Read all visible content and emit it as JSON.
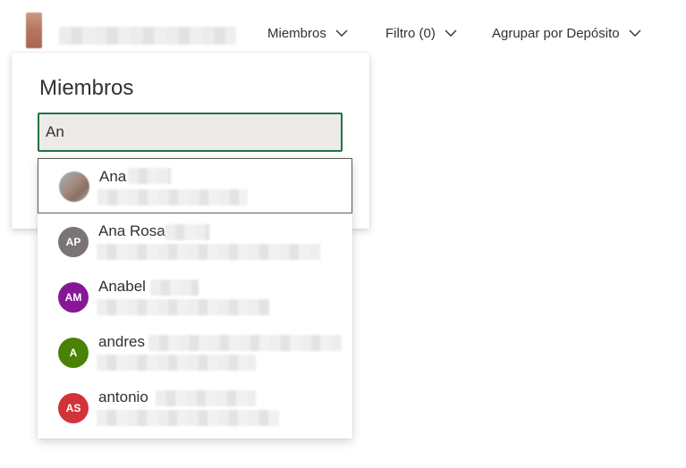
{
  "header": {
    "menus": [
      {
        "label": "Miembros"
      },
      {
        "label": "Filtro (0)"
      },
      {
        "label": "Agrupar por Depósito"
      }
    ]
  },
  "panel": {
    "title": "Miembros",
    "search": {
      "value": "An",
      "placeholder": ""
    }
  },
  "suggestions": [
    {
      "name": "Ana",
      "initials": "",
      "avatar_color": "#9fb6c2",
      "has_photo": true,
      "selected": true
    },
    {
      "name": "Ana Rosa",
      "initials": "AP",
      "avatar_color": "#7a7574",
      "selected": false
    },
    {
      "name": "Anabel",
      "initials": "AM",
      "avatar_color": "#881798",
      "selected": false
    },
    {
      "name": "andres",
      "initials": "A",
      "avatar_color": "#498205",
      "selected": false
    },
    {
      "name": "antonio",
      "initials": "AS",
      "avatar_color": "#d13438",
      "selected": false
    }
  ],
  "colors": {
    "accent": "#217346"
  }
}
